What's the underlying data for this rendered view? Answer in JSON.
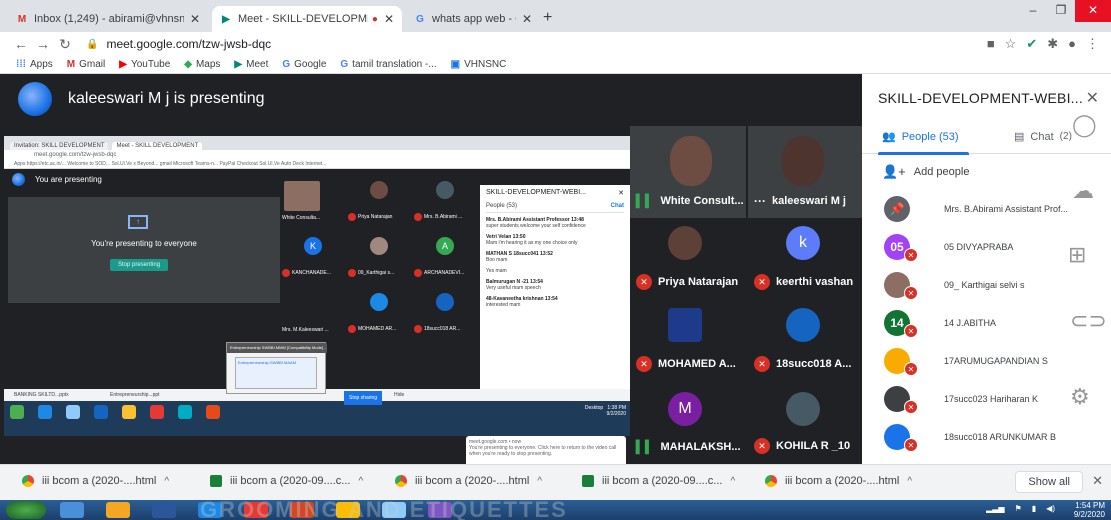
{
  "browser": {
    "tabs": [
      {
        "title": "Inbox (1,249) - abirami@vhnsnc.",
        "icon": "gmail-icon",
        "active": false
      },
      {
        "title": "Meet - SKILL-DEVELOPMENT",
        "icon": "meet-icon",
        "active": true
      },
      {
        "title": "whats app web - Google Search",
        "icon": "google-icon",
        "active": false
      }
    ],
    "url": "meet.google.com/tzw-jwsb-dqc",
    "bookmarks": [
      {
        "label": "Apps",
        "icon": "apps-grid-icon"
      },
      {
        "label": "Gmail",
        "icon": "gmail-icon"
      },
      {
        "label": "YouTube",
        "icon": "youtube-icon"
      },
      {
        "label": "Maps",
        "icon": "maps-icon"
      },
      {
        "label": "Meet",
        "icon": "meet-icon"
      },
      {
        "label": "Google",
        "icon": "google-icon"
      },
      {
        "label": "tamil translation -...",
        "icon": "google-icon"
      },
      {
        "label": "VHNSNC",
        "icon": "site-icon"
      }
    ]
  },
  "meet": {
    "presenter_text": "kaleeswari M j is presenting",
    "tiles": [
      {
        "name": "White Consult...",
        "muted": false
      },
      {
        "name": "kaleeswari M j",
        "muted": false
      },
      {
        "name": "Priya Natarajan",
        "muted": true
      },
      {
        "name": "keerthi vashan",
        "muted": true,
        "letter": "k"
      },
      {
        "name": "MOHAMED A...",
        "muted": true
      },
      {
        "name": "18succ018 A...",
        "muted": true
      },
      {
        "name": "MAHALAKSH...",
        "muted": false,
        "letter": "M"
      },
      {
        "name": "KOHILA R _10",
        "muted": true
      }
    ],
    "shared_screen": {
      "tabs": [
        "Invitation: SKILL DEVELOPMENT",
        "Meet - SKILL DEVELOPMENT"
      ],
      "address": "meet.google.com/tzw-jwsb-dqc",
      "bookmarks": "Apps  https://etc.ac.in/...  Welcome to SOD...  Sol.Ul.Ve x Beyond...  gmail  Microsoft Teams-n...  PayPal Checkout  Sol.Ul.Ve  Auto Deck Internet...",
      "you_are_presenting": "You are presenting",
      "presenting_everyone": "You're presenting to everyone",
      "stop_presenting": "Stop presenting",
      "mini_tiles": [
        {
          "name": "White Consulta...",
          "letter": ""
        },
        {
          "name": "Priya Natarajan",
          "letter": ""
        },
        {
          "name": "Mrs. B.Abirami ...",
          "letter": ""
        },
        {
          "name": "KANCHANADE...",
          "letter": "K"
        },
        {
          "name": "09_Karthigai s...",
          "letter": ""
        },
        {
          "name": "ARCHANADEVI...",
          "letter": "A"
        },
        {
          "name": "Mrs. M.Kaleeswari ...",
          "letter": ""
        },
        {
          "name": "MOHAMED AR...",
          "letter": ""
        },
        {
          "name": "18succ018 AR...",
          "letter": ""
        }
      ],
      "chat_title": "SKILL-DEVELOPMENT-WEBI...",
      "chat_tabs": [
        "People (53)",
        "Chat"
      ],
      "messages": [
        {
          "author": "Mrs. B.Abirami Assistant Professor  13:48",
          "text": "super students welcome your self confidence"
        },
        {
          "author": "Vetri Velan  13:50",
          "text": "Mam i'm hearing it as my one choice only"
        },
        {
          "author": "MATHAN S 18succ041  13:52",
          "text": "Boo mam"
        },
        {
          "author": "",
          "text": "Yes mam"
        },
        {
          "author": "Balmurugan N -21  13:54",
          "text": "Very useful mam speech"
        },
        {
          "author": "48-Kavaneetha krishnan  13:54",
          "text": "interested mam"
        }
      ],
      "notify_site": "meet.google.com • now",
      "notify_text": "You're presenting to everyone. Click here to return to the video call when you're ready to stop presenting.",
      "thumb_caption": "Entrepreneurship SWBBI MMM [Compatibility Mode] ...",
      "thumb_inner": "Entrepreneurship-SWBBI MAAM",
      "downloads": [
        "BANKING SKILTD...pptx",
        "Entrepreneurship...ppt"
      ],
      "stop_sharing": "Stop sharing",
      "hide": "Hide",
      "desktop": "Desktop",
      "time": "1:38 PM",
      "date": "9/2/2020"
    }
  },
  "panel": {
    "title": "SKILL-DEVELOPMENT-WEBI...",
    "people_tab": "People (53)",
    "chat_tab": "Chat",
    "chat_badge": "2",
    "add_people": "Add people",
    "participants": [
      {
        "name": "Mrs. B.Abirami Assistant Prof...",
        "avatar": "",
        "color": "#5f6368"
      },
      {
        "name": "05 DIVYAPRABA",
        "avatar": "05",
        "color": "#a142f4"
      },
      {
        "name": "09_ Karthigai selvi s",
        "avatar": "",
        "color": "#8d6e63"
      },
      {
        "name": "14 J.ABITHA",
        "avatar": "14",
        "color": "#137333"
      },
      {
        "name": "17ARUMUGAPANDIAN S",
        "avatar": "",
        "color": "#f9ab00"
      },
      {
        "name": "17succ023 Hariharan K",
        "avatar": "",
        "color": "#3c4043"
      },
      {
        "name": "18succ018 ARUNKUMAR B",
        "avatar": "",
        "color": "#1a73e8"
      }
    ]
  },
  "download_bar": {
    "items": [
      {
        "label": "iii bcom a (2020-....html",
        "icon": "chrome-icon"
      },
      {
        "label": "iii bcom a (2020-09....c...",
        "icon": "csv-file-icon"
      },
      {
        "label": "iii bcom a (2020-....html",
        "icon": "chrome-icon"
      },
      {
        "label": "iii bcom a (2020-09....c...",
        "icon": "csv-file-icon"
      },
      {
        "label": "iii bcom a (2020-....html",
        "icon": "chrome-icon"
      }
    ],
    "show_all": "Show all"
  },
  "taskbar": {
    "watermark": "GROOMING AND ETIQUETTES",
    "time": "1:54 PM",
    "date": "9/2/2020"
  },
  "colors": {
    "meet_bg": "#202124",
    "accent": "#1a73e8",
    "muted_red": "#d93025"
  }
}
